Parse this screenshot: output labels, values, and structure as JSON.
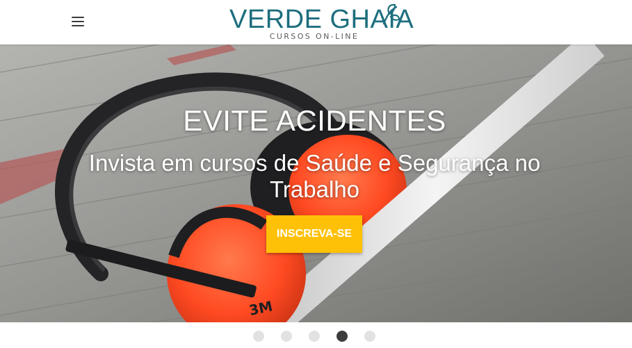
{
  "header": {
    "logo_title": "VERDE GHAIA",
    "logo_subtitle": "CURSOS ON-LINE",
    "menu_icon": "hamburger-menu-icon"
  },
  "hero": {
    "title": "EVITE ACIDENTES",
    "subtitle": "Invista em cursos de Saúde e Segurança no Trabalho",
    "cta_label": "INSCREVA-SE",
    "image": "orange ear-protection earmuffs on wooden deck"
  },
  "carousel": {
    "slide_count": 5,
    "active_slide": 4
  },
  "colors": {
    "brand": "#1d6e7e",
    "cta": "#ffc107",
    "earmuff": "#ff4a22",
    "dot_inactive": "#e2e2e2",
    "dot_active": "#3d3d3d"
  }
}
